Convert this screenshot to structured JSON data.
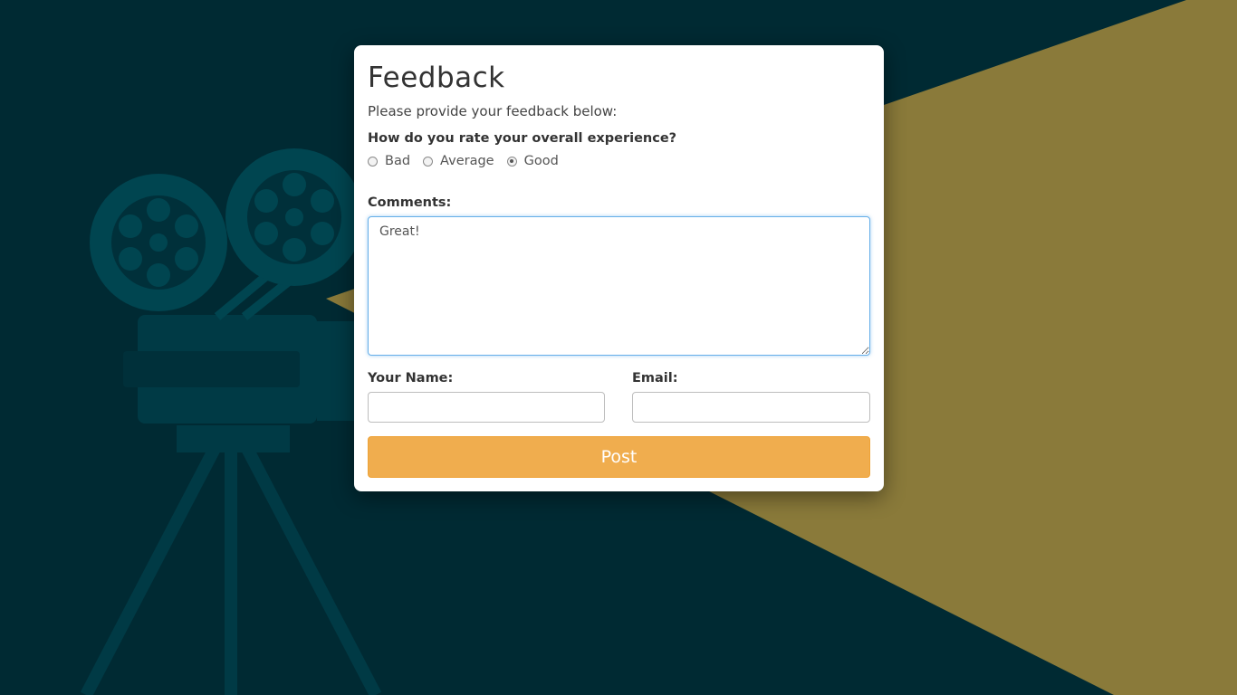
{
  "colors": {
    "background": "#002a33",
    "spotlight": "#8a7a3a",
    "projector": "#004550",
    "card": "#ffffff",
    "button": "#f0ad4e",
    "focus_border": "#66afe9"
  },
  "form": {
    "title": "Feedback",
    "subtitle": "Please provide your feedback below:",
    "question": "How do you rate your overall experience?",
    "rating_options": [
      {
        "label": "Bad",
        "checked": false
      },
      {
        "label": "Average",
        "checked": false
      },
      {
        "label": "Good",
        "checked": true
      }
    ],
    "comments_label": "Comments:",
    "comments_value": "Great!",
    "name_label": "Your Name:",
    "name_value": "",
    "email_label": "Email:",
    "email_value": "",
    "submit_label": "Post"
  },
  "background": {
    "illustration": "film-projector-icon"
  }
}
